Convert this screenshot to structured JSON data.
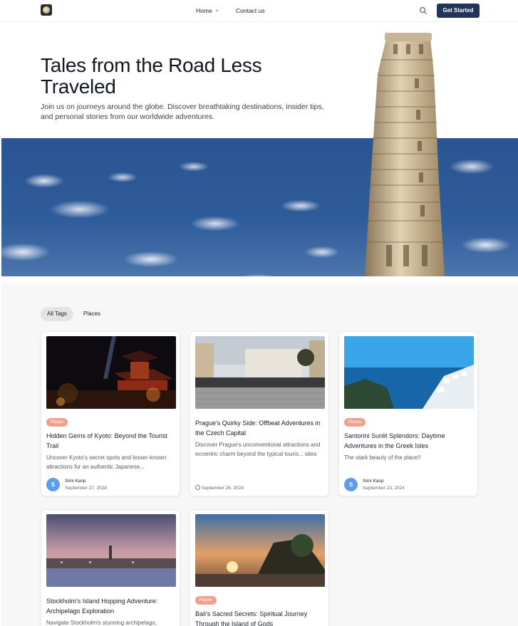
{
  "nav": {
    "home_label": "Home",
    "contact_label": "Contact us",
    "cta_label": "Get Started"
  },
  "hero": {
    "title": "Tales from the Road Less Traveled",
    "subtitle": "Join us on journeys around the globe. Discover breathtaking destinations, insider tips, and personal stories from our worldwide adventures."
  },
  "tags": [
    "All Tags",
    "Places"
  ],
  "cards": [
    {
      "badge": "Places",
      "title": "Hidden Gems of Kyoto: Beyond the Tourist Trail",
      "desc": "Uncover Kyoto's secret spots and lesser-known attractions for an authentic Japanese...",
      "author_initial": "S",
      "author": "Simi Kanp",
      "date": "September 27, 2024"
    },
    {
      "title": "Prague's Quirky Side: Offbeat Adventures in the Czech Capital",
      "desc": "Discover Prague's unconventional attractions and eccentric charm beyond the typical touris... sites",
      "date": "September 26, 2024"
    },
    {
      "badge": "Places",
      "title": "Santorini Sunlit Splendors: Daytime Adventures in the Greek Isles",
      "desc": "The stark beauty of the place!!",
      "author_initial": "S",
      "author": "Simi Kanp",
      "date": "September 23, 2024"
    },
    {
      "title": "Stockholm's Island Hopping Adventure: Archipelago Exploration",
      "desc": "Navigate Stockholm's stunning archipelago,"
    },
    {
      "badge": "Places",
      "title": "Bali's Sacred Secrets: Spiritual Journey Through the Island of Gods"
    }
  ]
}
